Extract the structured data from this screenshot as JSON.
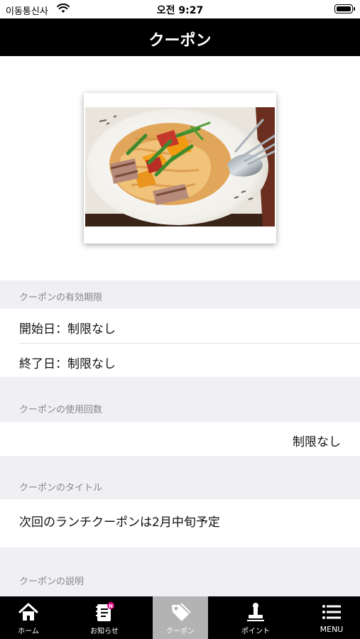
{
  "status_bar": {
    "carrier": "이동통신사",
    "time": "오전 9:27"
  },
  "header": {
    "title": "クーポン"
  },
  "coupon": {
    "validity": {
      "label": "クーポンの有効期限",
      "start": "開始日：制限なし",
      "end": "終了日：制限なし"
    },
    "usage": {
      "label": "クーポンの使用回数",
      "value": "制限なし"
    },
    "title_section": {
      "label": "クーポンのタイトル",
      "value": "次回のランチクーポンは2月中旬予定"
    },
    "description": {
      "label": "クーポンの説明"
    }
  },
  "tab_bar": {
    "tabs": [
      {
        "label": "ホーム",
        "icon": "home-icon"
      },
      {
        "label": "お知らせ",
        "icon": "notebook-icon",
        "badge": "N"
      },
      {
        "label": "クーポン",
        "icon": "tag-icon",
        "active": true
      },
      {
        "label": "ポイント",
        "icon": "stamp-icon"
      },
      {
        "label": "MENU",
        "icon": "menu-icon"
      }
    ]
  },
  "colors": {
    "header_bg": "#000000",
    "tab_active_bg": "#b3b3b3",
    "section_bg": "#efeff4",
    "badge": "#e6007e"
  }
}
